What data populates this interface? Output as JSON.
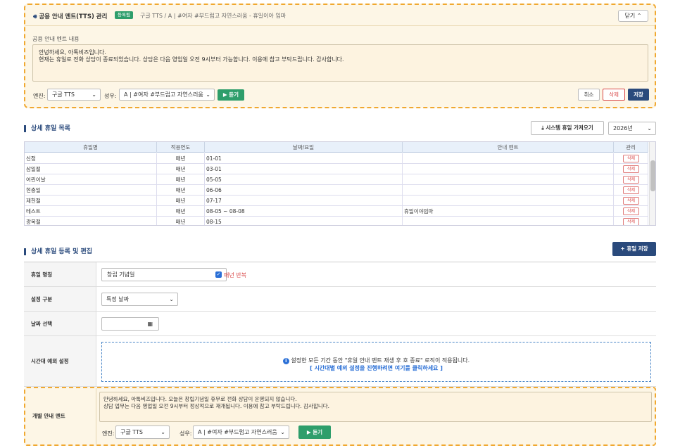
{
  "tts_panel": {
    "title": "공용 안내 멘트(TTS) 관리",
    "badge": "등록됨",
    "subtitle": "구글 TTS / A | #여자 #부드럽고 자연스러움 - 휴일이아 임마",
    "close_label": "닫기",
    "content_label": "공용 안내 멘트 내용",
    "content_line1": "안녕하세요, 아톡비즈입니다.",
    "content_line2": "현재는 휴일로 전화 상담이 종료되었습니다. 상담은 다음 영업일 오전 9시부터 가능합니다. 이용에 참고 부탁드립니다. 감사합니다.",
    "engine_label": "엔진:",
    "engine_value": "구글 TTS",
    "voice_label": "성우:",
    "voice_value": "A | #여자 #부드럽고 자연스러움",
    "listen_label": "▶ 듣기",
    "cancel_label": "취소",
    "delete_label": "삭제",
    "save_label": "저장"
  },
  "holiday_list": {
    "title": "상세 휴일 목록",
    "import_label": "시스템 휴일 가져오기",
    "year_value": "2026년",
    "columns": [
      "휴일명",
      "적용연도",
      "날짜/요일",
      "안내 멘트",
      "관리"
    ],
    "delete_label": "삭제",
    "rows": [
      {
        "name": "신정",
        "year": "매년",
        "date": "01-01",
        "msg": ""
      },
      {
        "name": "삼일절",
        "year": "매년",
        "date": "03-01",
        "msg": ""
      },
      {
        "name": "어린이날",
        "year": "매년",
        "date": "05-05",
        "msg": ""
      },
      {
        "name": "현충일",
        "year": "매년",
        "date": "06-06",
        "msg": ""
      },
      {
        "name": "제헌절",
        "year": "매년",
        "date": "07-17",
        "msg": ""
      },
      {
        "name": "테스트",
        "year": "매년",
        "date": "08-05 ~ 08-08",
        "msg": "휴일이야임마"
      },
      {
        "name": "광복절",
        "year": "매년",
        "date": "08-15",
        "msg": ""
      }
    ]
  },
  "edit": {
    "title": "상세 휴일 등록 및 편집",
    "save_holiday_label": "+ 휴일 저장",
    "name_label": "휴일 명칭",
    "name_value": "창립 기념일",
    "repeat_label": "매년 반복",
    "type_label": "설정 구분",
    "type_value": "특정 날짜",
    "date_label": "날짜 선택",
    "time_label": "시간대 예외 설정",
    "time_notice": "설정한 모든 기간 동안 \"휴일 안내 멘트 재생 후 호 종료\" 로직이 적용됩니다.",
    "time_link": "[ 시간대별 예외 설정을 진행하려면 여기를 클릭하세요 ]",
    "indiv_label": "개별 안내 멘트",
    "indiv_line1": "안녕하세요, 아톡비즈입니다. 오늘은 창립기념일 휴무로 전화 상담이 운영되지 않습니다.",
    "indiv_line2": "상담 업무는 다음 영업일 오전 9시부터 정상적으로 재개됩니다. 이용에 참고 부탁드립니다. 감사합니다.",
    "engine_label": "엔진:",
    "engine_value": "구글 TTS",
    "voice_label": "성우:",
    "voice_value": "A | #여자 #부드럽고 자연스러움",
    "listen_label": "▶ 듣기"
  },
  "colors": {
    "accent": "#2a4a7c",
    "green": "#2e9e6b",
    "danger": "#d94848",
    "warn_border": "#f0a830"
  }
}
